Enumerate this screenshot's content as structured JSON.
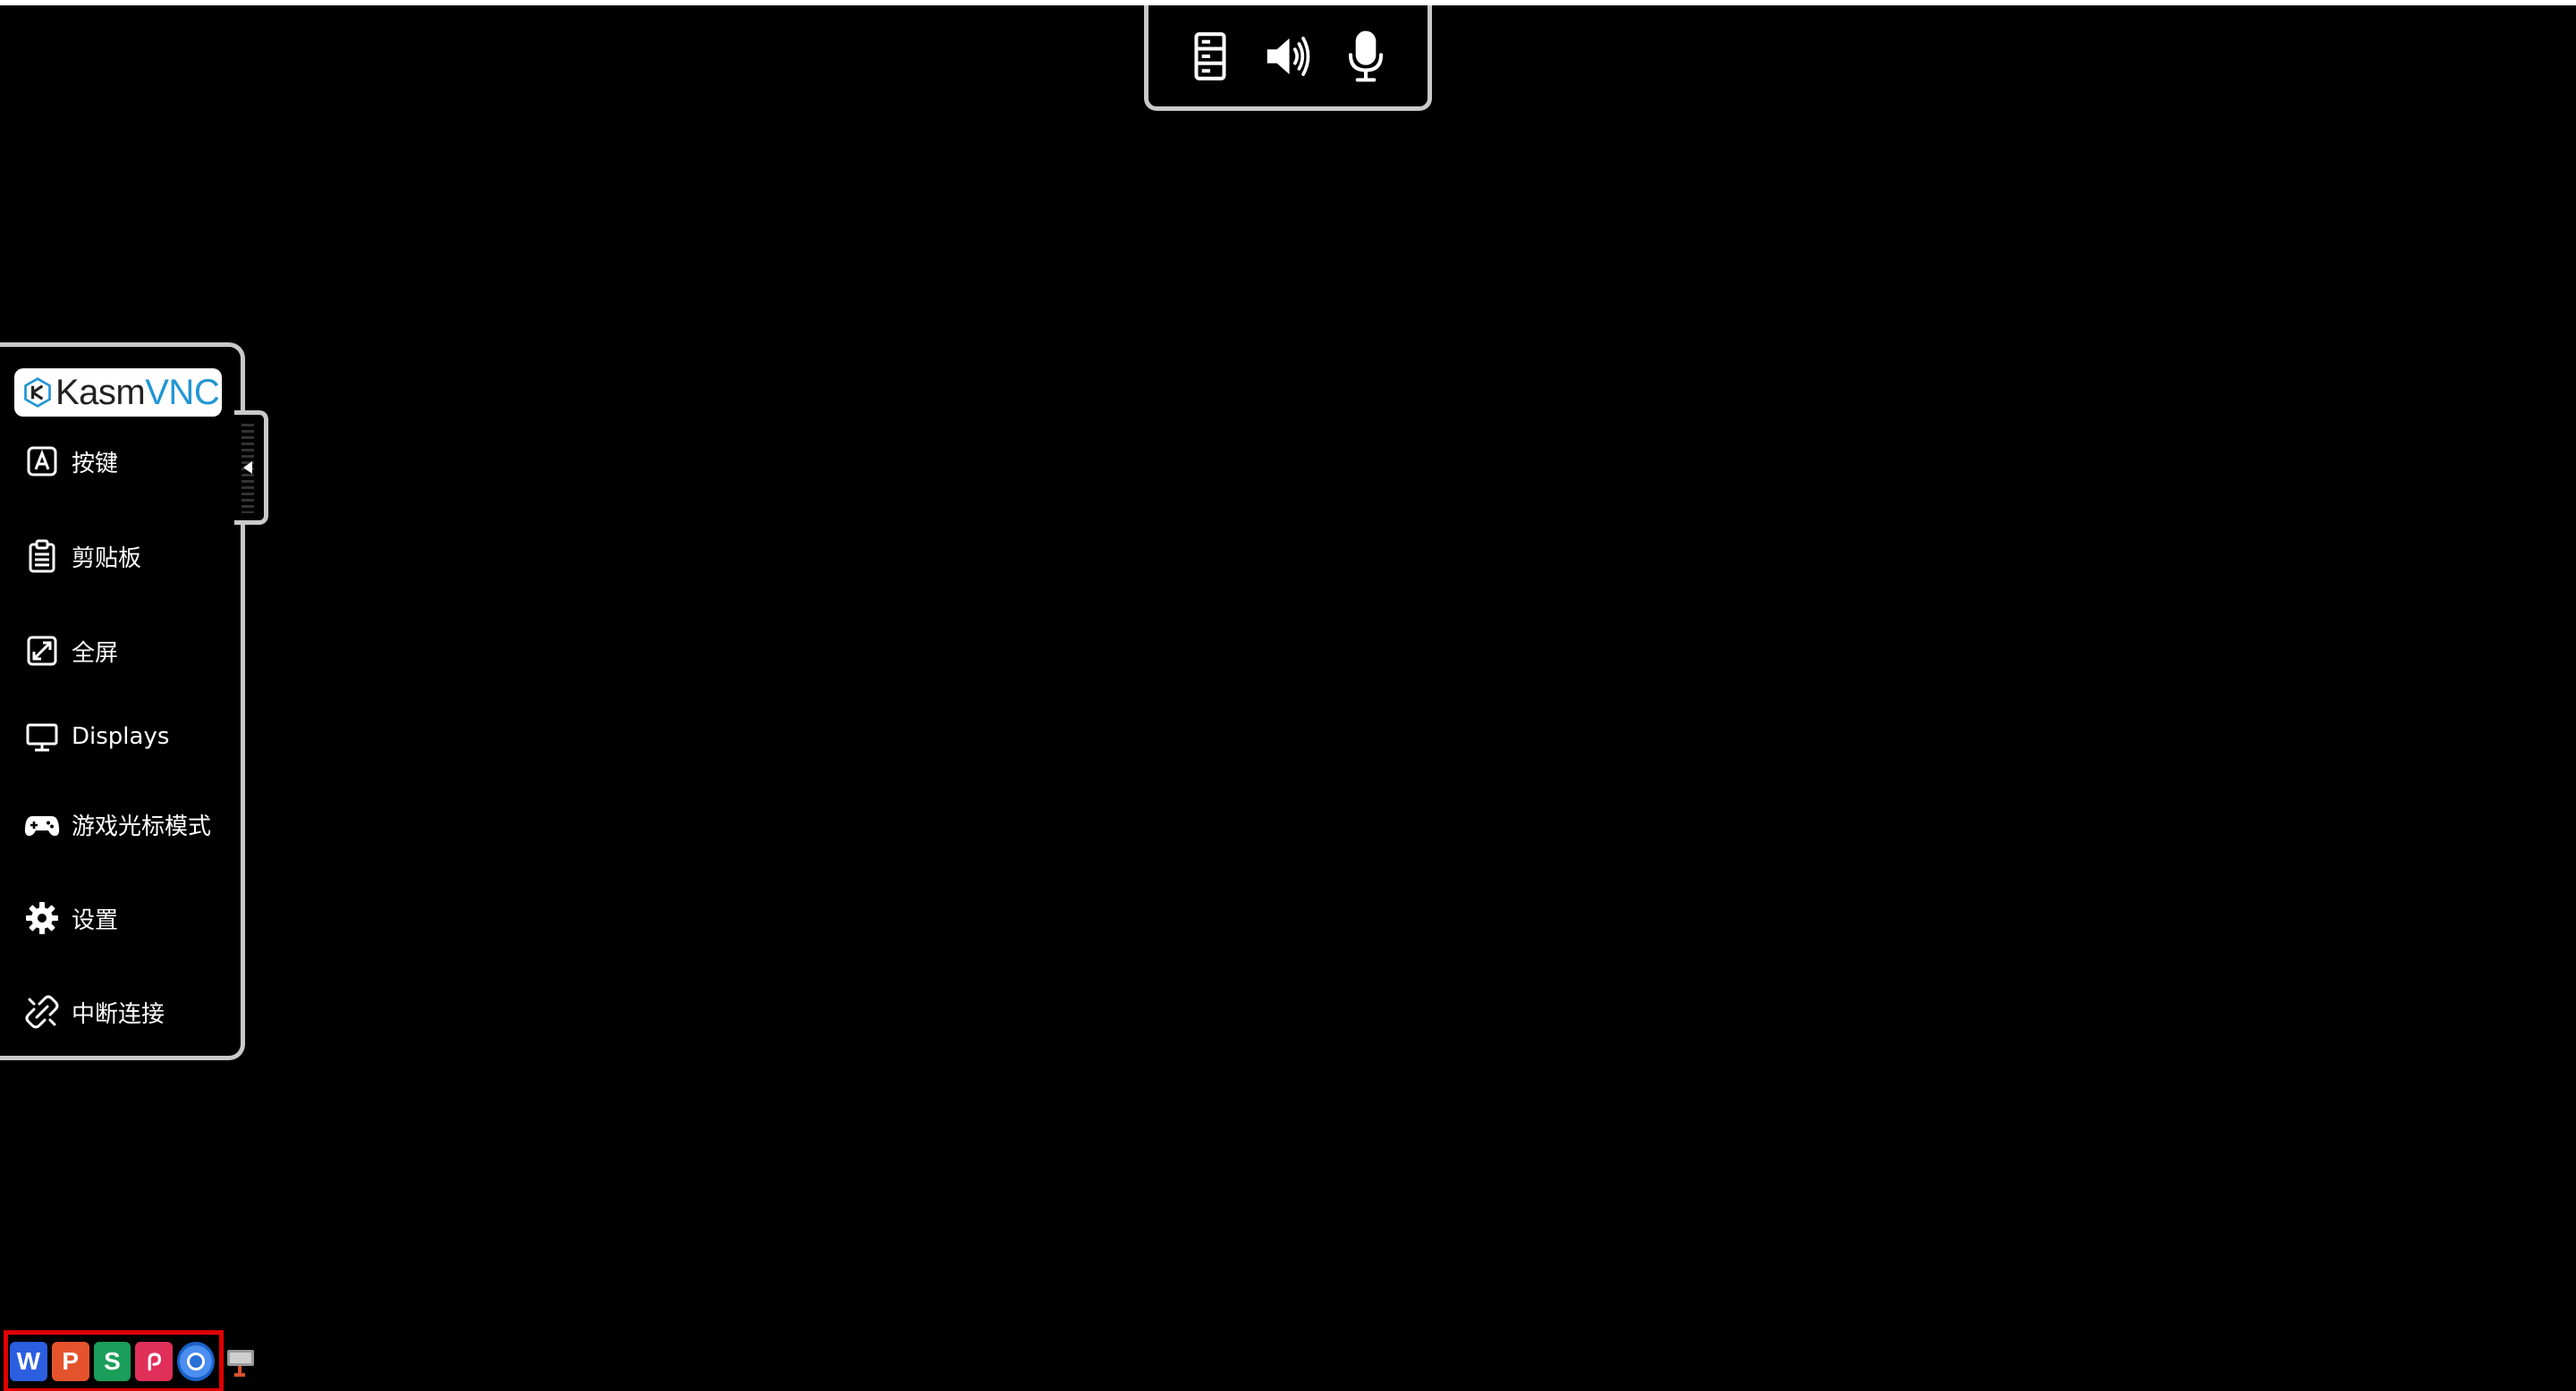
{
  "top_bar": {
    "icons": [
      "server-icon",
      "speaker-icon",
      "microphone-icon"
    ]
  },
  "control_bar": {
    "logo": {
      "part1": "Kasm",
      "part2": "VNC"
    },
    "items": [
      {
        "label": "按键",
        "icon": "keyboard-key-icon"
      },
      {
        "label": "剪贴板",
        "icon": "clipboard-icon"
      },
      {
        "label": "全屏",
        "icon": "fullscreen-icon"
      },
      {
        "label": "Displays",
        "icon": "monitor-icon"
      },
      {
        "label": "游戏光标模式",
        "icon": "gamepad-icon"
      },
      {
        "label": "设置",
        "icon": "gear-icon"
      },
      {
        "label": "中断连接",
        "icon": "disconnect-icon"
      }
    ]
  },
  "taskbar": {
    "apps": [
      {
        "name": "wps-writer",
        "letter": "W",
        "color": "#2b5fe0"
      },
      {
        "name": "wps-presentation",
        "letter": "P",
        "color": "#e5532d"
      },
      {
        "name": "wps-spreadsheet",
        "letter": "S",
        "color": "#1b9e5a"
      },
      {
        "name": "wps-pdf",
        "letter": "",
        "color": "#e0305a"
      },
      {
        "name": "chromium",
        "letter": "",
        "color": "#4a8ef0"
      }
    ]
  },
  "colors": {
    "background": "#000000",
    "border": "#c9c9c9",
    "logo_accent": "#2196d3",
    "highlight": "#e00000"
  }
}
